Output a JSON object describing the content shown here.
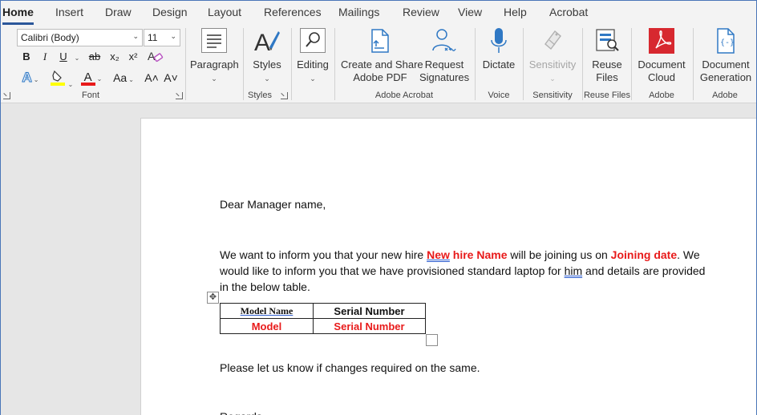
{
  "tabs": [
    {
      "label": "Home",
      "active": true
    },
    {
      "label": "Insert"
    },
    {
      "label": "Draw"
    },
    {
      "label": "Design"
    },
    {
      "label": "Layout"
    },
    {
      "label": "References"
    },
    {
      "label": "Mailings"
    },
    {
      "label": "Review"
    },
    {
      "label": "View"
    },
    {
      "label": "Help"
    },
    {
      "label": "Acrobat"
    }
  ],
  "font_group": {
    "font_name": "Calibri (Body)",
    "font_size": "11",
    "bold": "B",
    "italic": "I",
    "underline": "U",
    "strike": "ab",
    "subscript": "x₂",
    "superscript": "x²",
    "text_effects": "A",
    "font_color": "A",
    "change_case": "Aa",
    "grow_font": "A˄",
    "shrink_font": "A˅",
    "label": "Font"
  },
  "buttons": {
    "paragraph": "Paragraph",
    "styles": "Styles",
    "editing": "Editing",
    "create_share_line1": "Create and Share",
    "create_share_line2": "Adobe PDF",
    "request_line1": "Request",
    "request_line2": "Signatures",
    "dictate": "Dictate",
    "sensitivity": "Sensitivity",
    "reuse_line1": "Reuse",
    "reuse_line2": "Files",
    "doccloud_line1": "Document",
    "doccloud_line2": "Cloud",
    "docgen_line1": "Document",
    "docgen_line2": "Generation"
  },
  "group_labels": {
    "styles": "Styles",
    "adobe_acrobat": "Adobe Acrobat",
    "voice": "Voice",
    "sensitivity": "Sensitivity",
    "reuse_files": "Reuse Files",
    "adobe1": "Adobe",
    "adobe2": "Adobe"
  },
  "colors": {
    "accent": "#2b579a",
    "highlight": "#ffff00",
    "font_color_bar": "#e81a1a",
    "template_field": "#e81a1a",
    "adobe_red": "#d7282f",
    "icon_blue": "#2f78c4"
  },
  "document": {
    "greeting": "Dear Manager name,",
    "p1_a": "We want to inform you that your new hire ",
    "p1_new": "New",
    "p1_hire_name": " hire Name",
    "p1_b": " will be joining us on ",
    "p1_date": "Joining date",
    "p1_c": ". We",
    "p2_a": "would like to inform you that we have provisioned standard laptop for ",
    "p2_him": "him",
    "p2_b": " and details are provided",
    "p3": "in the below table.",
    "table": {
      "headers": [
        "Model  Name",
        "Serial Number"
      ],
      "row": [
        "Model",
        "Serial Number"
      ]
    },
    "closing_line": "Please let us know if changes required on the same.",
    "cutoff_line": "Regards,"
  }
}
